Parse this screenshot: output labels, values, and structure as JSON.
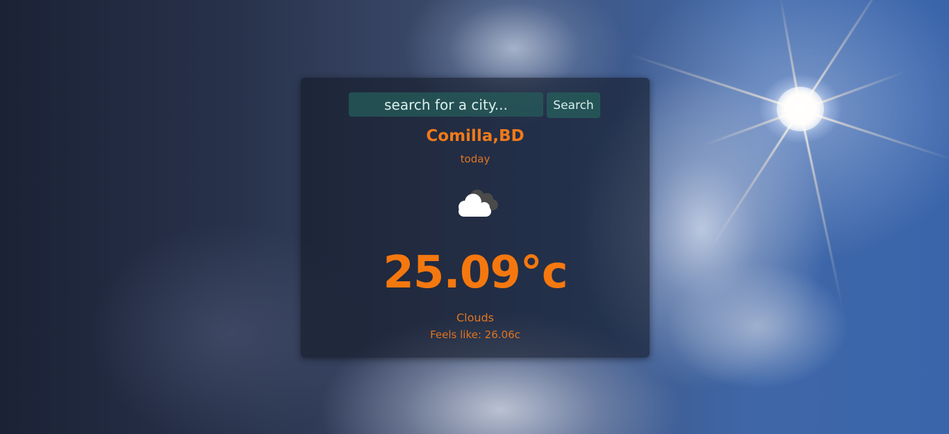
{
  "search": {
    "placeholder": "search for a city...",
    "button_label": "Search"
  },
  "weather": {
    "location": "Comilla,BD",
    "day": "today",
    "icon": "clouds-icon",
    "temperature": "25.09°c",
    "condition": "Clouds",
    "feels_like": "Feels like: 26.06c"
  },
  "colors": {
    "accent": "#f5780f",
    "search_bg": "#265c5a",
    "search_text": "#d9efeb",
    "card_bg": "#141a28"
  }
}
